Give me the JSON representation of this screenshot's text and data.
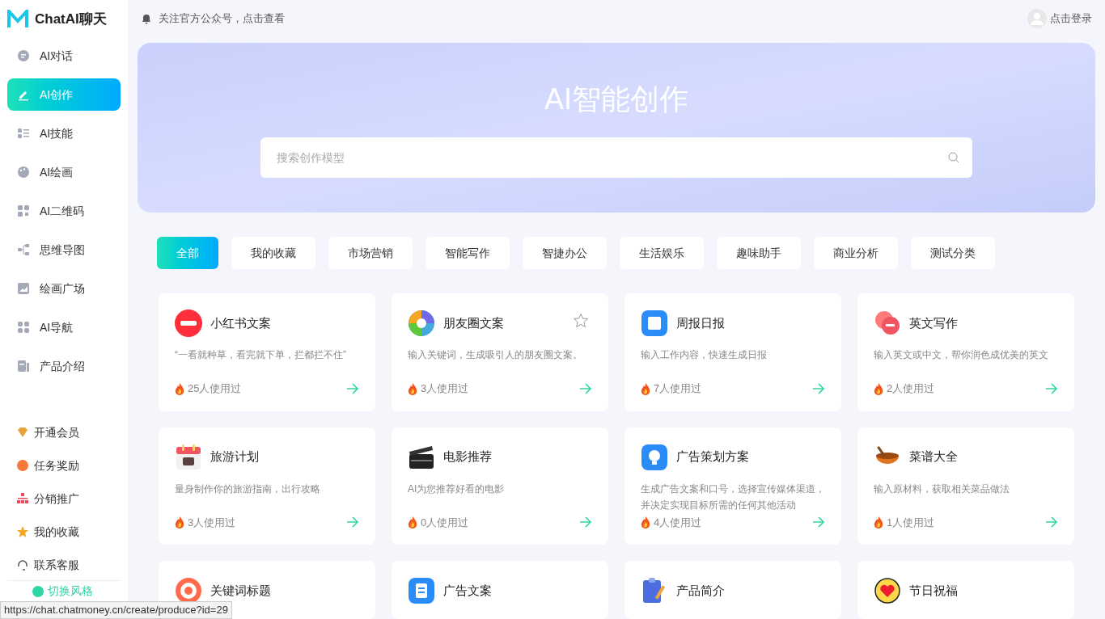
{
  "brand": {
    "name": "ChatAI聊天"
  },
  "sidebar": {
    "items": [
      {
        "label": "AI对话",
        "selected": false
      },
      {
        "label": "AI创作",
        "selected": true
      },
      {
        "label": "AI技能",
        "selected": false
      },
      {
        "label": "AI绘画",
        "selected": false
      },
      {
        "label": "AI二维码",
        "selected": false
      },
      {
        "label": "思维导图",
        "selected": false
      },
      {
        "label": "绘画广场",
        "selected": false
      },
      {
        "label": "AI导航",
        "selected": false
      },
      {
        "label": "产品介绍",
        "selected": false
      }
    ],
    "bottom_items": [
      {
        "label": "开通会员"
      },
      {
        "label": "任务奖励"
      },
      {
        "label": "分销推广"
      },
      {
        "label": "我的收藏"
      },
      {
        "label": "联系客服"
      }
    ],
    "theme_switch": "切换风格"
  },
  "header": {
    "notice": "关注官方公众号，点击查看",
    "login": "点击登录"
  },
  "banner": {
    "title": "AI智能创作",
    "search": {
      "placeholder": "搜索创作模型"
    }
  },
  "tabs": [
    {
      "label": "全部",
      "selected": true
    },
    {
      "label": "我的收藏",
      "selected": false
    },
    {
      "label": "市场营销",
      "selected": false
    },
    {
      "label": "智能写作",
      "selected": false
    },
    {
      "label": "智捷办公",
      "selected": false
    },
    {
      "label": "生活娱乐",
      "selected": false
    },
    {
      "label": "趣味助手",
      "selected": false
    },
    {
      "label": "商业分析",
      "selected": false
    },
    {
      "label": "测试分类",
      "selected": false
    }
  ],
  "cards": [
    {
      "title": "小红书文案",
      "description": "“一看就种草，看完就下单，拦都拦不住”",
      "usage": "25人使用过",
      "hovered": false
    },
    {
      "title": "朋友圈文案",
      "description": "输入关键词，生成吸引人的朋友圈文案。",
      "usage": "3人使用过",
      "hovered": true
    },
    {
      "title": "周报日报",
      "description": "输入工作内容，快速生成日报",
      "usage": "7人使用过",
      "hovered": false
    },
    {
      "title": "英文写作",
      "description": "输入英文或中文，帮你润色成优美的英文",
      "usage": "2人使用过",
      "hovered": false
    },
    {
      "title": "旅游计划",
      "description": "量身制作你的旅游指南，出行攻略",
      "usage": "3人使用过",
      "hovered": false
    },
    {
      "title": "电影推荐",
      "description": "AI为您推荐好看的电影",
      "usage": "0人使用过",
      "hovered": false
    },
    {
      "title": "广告策划方案",
      "description": "生成广告文案和口号，选择宣传媒体渠道，并决定实现目标所需的任何其他活动",
      "usage": "4人使用过",
      "hovered": false
    },
    {
      "title": "菜谱大全",
      "description": "输入原材料，获取相关菜品做法",
      "usage": "1人使用过",
      "hovered": false
    },
    {
      "title": "关键词标题",
      "hovered": false
    },
    {
      "title": "广告文案",
      "hovered": false
    },
    {
      "title": "产品简介",
      "hovered": false
    },
    {
      "title": "节日祝福",
      "hovered": false
    }
  ],
  "status_url": "https://chat.chatmoney.cn/create/produce?id=29"
}
